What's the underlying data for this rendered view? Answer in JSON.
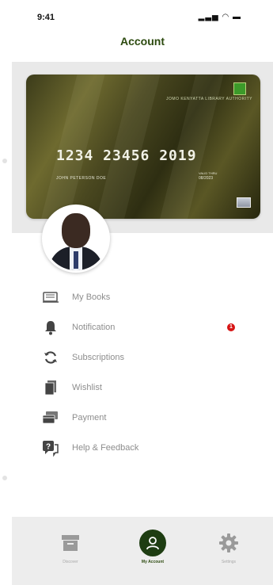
{
  "status_bar": {
    "time": "9:41",
    "icons": "signal-icon wifi-icon battery-icon"
  },
  "header": {
    "title": "Account"
  },
  "card": {
    "org_name": "JOMO KENYATTA LIBRARY AUTHORITY",
    "number": "1234 23456 2019",
    "holder": "JOHN PETERSON DOE",
    "valid_label": "VALID THRU",
    "expiry": "08/2023"
  },
  "menu": {
    "items": [
      {
        "label": "My Books",
        "icon": "books-icon"
      },
      {
        "label": "Notification",
        "icon": "bell-icon",
        "badge": "1"
      },
      {
        "label": "Subscriptions",
        "icon": "refresh-icon"
      },
      {
        "label": "Wishlist",
        "icon": "wishlist-icon"
      },
      {
        "label": "Payment",
        "icon": "payment-icon"
      },
      {
        "label": "Help & Feedback",
        "icon": "help-icon"
      }
    ]
  },
  "tabbar": {
    "tabs": [
      {
        "label": "Discover",
        "icon": "archive-icon"
      },
      {
        "label": "My Account",
        "icon": "user-icon",
        "active": true
      },
      {
        "label": "Settings",
        "icon": "gear-icon"
      }
    ]
  },
  "colors": {
    "accent": "#1e3d12",
    "title": "#2c4a0f",
    "badge": "#d71414",
    "background": "#e9e9e9"
  }
}
